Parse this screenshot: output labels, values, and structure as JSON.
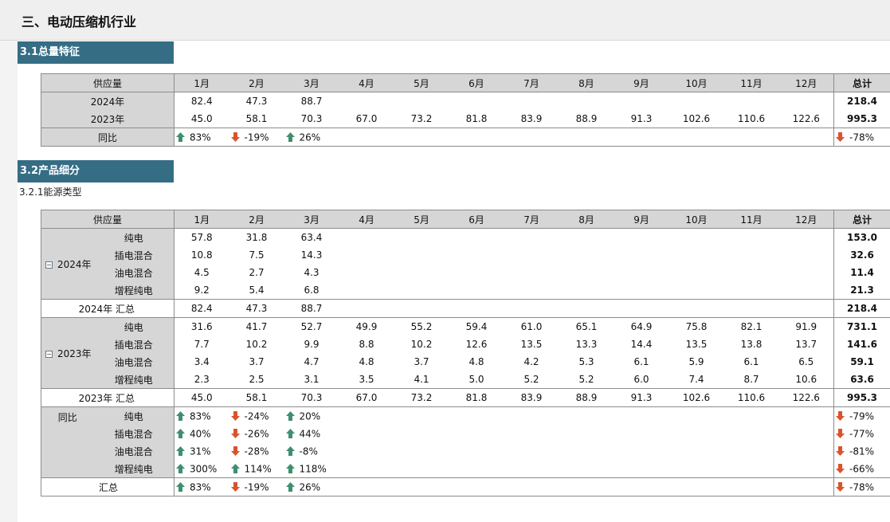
{
  "page_title": "三、电动压缩机行业",
  "section1": {
    "title": "3.1总量特征"
  },
  "section2": {
    "title": "3.2产品细分",
    "subtitle": "3.2.1能源类型"
  },
  "months": [
    "1月",
    "2月",
    "3月",
    "4月",
    "5月",
    "6月",
    "7月",
    "8月",
    "9月",
    "10月",
    "11月",
    "12月"
  ],
  "table1": {
    "header_label": "供应量",
    "total_label": "总计",
    "rows": [
      {
        "label": "2024年",
        "values": [
          "82.4",
          "47.3",
          "88.7",
          "",
          "",
          "",
          "",
          "",
          "",
          "",
          "",
          ""
        ],
        "total": "218.4"
      },
      {
        "label": "2023年",
        "values": [
          "45.0",
          "58.1",
          "70.3",
          "67.0",
          "73.2",
          "81.8",
          "83.9",
          "88.9",
          "91.3",
          "102.6",
          "110.6",
          "122.6"
        ],
        "total": "995.3"
      }
    ],
    "yoy": {
      "label": "同比",
      "values": [
        [
          "83%",
          "up"
        ],
        [
          "-19%",
          "down"
        ],
        [
          "26%",
          "up"
        ]
      ],
      "total": [
        "-78%",
        "down"
      ]
    }
  },
  "table2": {
    "header_label": "供应量",
    "total_label": "总计",
    "groups": [
      {
        "label": "2024年",
        "rows": [
          {
            "label": "纯电",
            "values": [
              "57.8",
              "31.8",
              "63.4",
              "",
              "",
              "",
              "",
              "",
              "",
              "",
              "",
              ""
            ],
            "total": "153.0"
          },
          {
            "label": "插电混合",
            "values": [
              "10.8",
              "7.5",
              "14.3",
              "",
              "",
              "",
              "",
              "",
              "",
              "",
              "",
              ""
            ],
            "total": "32.6"
          },
          {
            "label": "油电混合",
            "values": [
              "4.5",
              "2.7",
              "4.3",
              "",
              "",
              "",
              "",
              "",
              "",
              "",
              "",
              ""
            ],
            "total": "11.4"
          },
          {
            "label": "增程纯电",
            "values": [
              "9.2",
              "5.4",
              "6.8",
              "",
              "",
              "",
              "",
              "",
              "",
              "",
              "",
              ""
            ],
            "total": "21.3"
          }
        ],
        "summary": {
          "label": "2024年 汇总",
          "values": [
            "82.4",
            "47.3",
            "88.7",
            "",
            "",
            "",
            "",
            "",
            "",
            "",
            "",
            ""
          ],
          "total": "218.4"
        }
      },
      {
        "label": "2023年",
        "rows": [
          {
            "label": "纯电",
            "values": [
              "31.6",
              "41.7",
              "52.7",
              "49.9",
              "55.2",
              "59.4",
              "61.0",
              "65.1",
              "64.9",
              "75.8",
              "82.1",
              "91.9"
            ],
            "total": "731.1"
          },
          {
            "label": "插电混合",
            "values": [
              "7.7",
              "10.2",
              "9.9",
              "8.8",
              "10.2",
              "12.6",
              "13.5",
              "13.3",
              "14.4",
              "13.5",
              "13.8",
              "13.7"
            ],
            "total": "141.6"
          },
          {
            "label": "油电混合",
            "values": [
              "3.4",
              "3.7",
              "4.7",
              "4.8",
              "3.7",
              "4.8",
              "4.2",
              "5.3",
              "6.1",
              "5.9",
              "6.1",
              "6.5"
            ],
            "total": "59.1"
          },
          {
            "label": "增程纯电",
            "values": [
              "2.3",
              "2.5",
              "3.1",
              "3.5",
              "4.1",
              "5.0",
              "5.2",
              "5.2",
              "6.0",
              "7.4",
              "8.7",
              "10.6"
            ],
            "total": "63.6"
          }
        ],
        "summary": {
          "label": "2023年 汇总",
          "values": [
            "45.0",
            "58.1",
            "70.3",
            "67.0",
            "73.2",
            "81.8",
            "83.9",
            "88.9",
            "91.3",
            "102.6",
            "110.6",
            "122.6"
          ],
          "total": "995.3"
        }
      }
    ],
    "yoy": {
      "label": "同比",
      "rows": [
        {
          "label": "纯电",
          "values": [
            [
              "83%",
              "up"
            ],
            [
              "-24%",
              "down"
            ],
            [
              "20%",
              "up"
            ]
          ],
          "total": [
            "-79%",
            "down"
          ]
        },
        {
          "label": "插电混合",
          "values": [
            [
              "40%",
              "up"
            ],
            [
              "-26%",
              "down"
            ],
            [
              "44%",
              "up"
            ]
          ],
          "total": [
            "-77%",
            "down"
          ]
        },
        {
          "label": "油电混合",
          "values": [
            [
              "31%",
              "up"
            ],
            [
              "-28%",
              "down"
            ],
            [
              "-8%",
              "up"
            ]
          ],
          "total": [
            "-81%",
            "down"
          ]
        },
        {
          "label": "增程纯电",
          "values": [
            [
              "300%",
              "up"
            ],
            [
              "114%",
              "up"
            ],
            [
              "118%",
              "up"
            ]
          ],
          "total": [
            "-66%",
            "down"
          ]
        }
      ],
      "summary": {
        "label": "汇总",
        "values": [
          [
            "83%",
            "up"
          ],
          [
            "-19%",
            "down"
          ],
          [
            "26%",
            "up"
          ]
        ],
        "total": [
          "-78%",
          "down"
        ]
      }
    }
  },
  "colors": {
    "arrow_up": "#3f8f6e",
    "arrow_down": "#d9532c",
    "section_bar": "#356d85"
  }
}
